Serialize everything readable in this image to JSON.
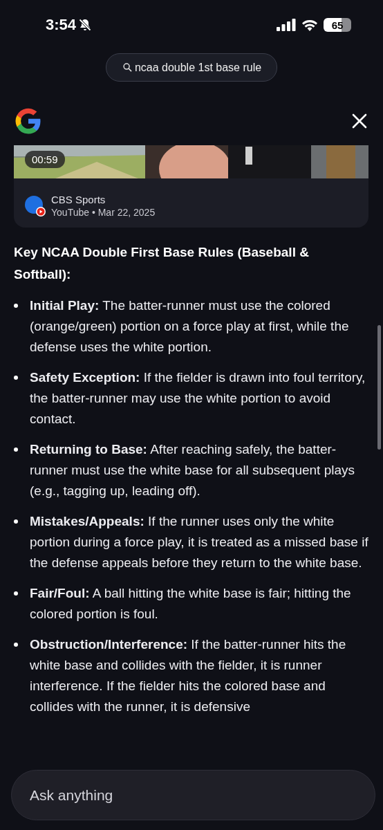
{
  "status_bar": {
    "time": "3:54",
    "battery": "65"
  },
  "search_chip": {
    "query": "ncaa double 1st base rule"
  },
  "video_card": {
    "duration": "00:59",
    "channel": "CBS Sports",
    "meta": "YouTube • Mar 22, 2025"
  },
  "answer": {
    "heading": "Key NCAA Double First Base Rules (Baseball & Softball):",
    "bullets": [
      "**Initial Play:** The batter-runner must use the colored (orange/green) portion on a force play at first, while the defense uses the white portion.",
      "**Safety Exception:** If the fielder is drawn into foul territory, the batter-runner may use the white portion to avoid contact.",
      "**Returning to Base:** After reaching safely, the batter-runner must use the white base for all subsequent plays (e.g., tagging up, leading off).",
      "**Mistakes/Appeals:** If the runner uses only the white portion during a force play, it is treated as a missed base if the defense appeals before they return to the white base.",
      "**Fair/Foul:** A ball hitting the white base is fair; hitting the colored portion is foul.",
      "**Obstruction/Interference:** If the batter-runner hits the white base and collides with the fielder, it is runner interference. If the fielder hits the colored base and collides with the runner, it is defensive"
    ]
  },
  "ask_field": {
    "placeholder": "Ask anything"
  }
}
